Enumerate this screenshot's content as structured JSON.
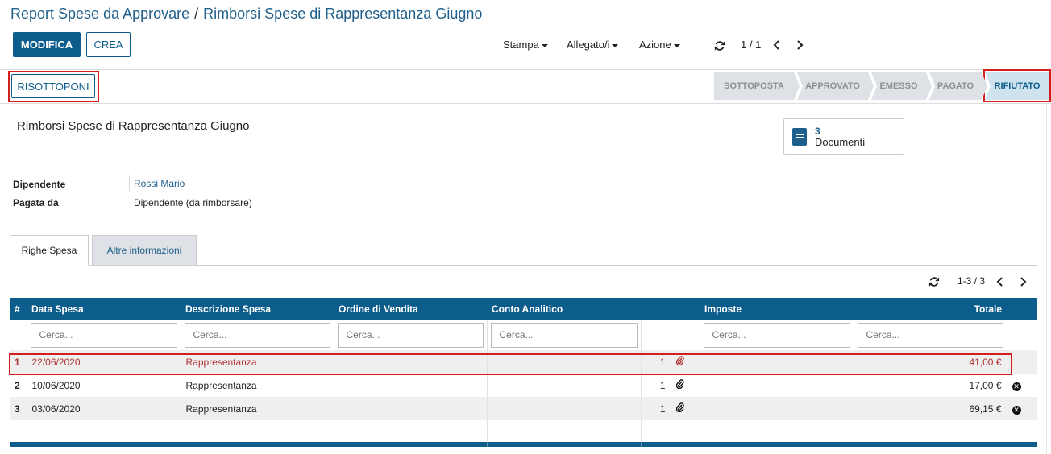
{
  "breadcrumb": {
    "parent": "Report Spese da Approvare",
    "separator": "/",
    "current": "Rimborsi Spese di Rappresentanza Giugno"
  },
  "control_panel": {
    "edit_label": "MODIFICA",
    "create_label": "CREA",
    "print_label": "Stampa",
    "attachment_label": "Allegato/i",
    "action_label": "Azione",
    "pager_value": "1 / 1"
  },
  "header_buttons": {
    "resubmit_label": "RISOTTOPONI"
  },
  "statusbar": {
    "stages": [
      "SOTTOPOSTA",
      "APPROVATO",
      "EMESSO",
      "PAGATO",
      "RIFIUTATO"
    ],
    "active_stage": "RIFIUTATO"
  },
  "record": {
    "title": "Rimborsi Spese di Rappresentanza Giugno",
    "documents_count": "3",
    "documents_label": "Documenti",
    "fields": [
      {
        "label": "Dipendente",
        "value": "Rossi Mario"
      },
      {
        "label": "Pagata da",
        "value": "Dipendente (da rimborsare)"
      }
    ]
  },
  "tabs": [
    "Righe Spesa",
    "Altre informazioni"
  ],
  "lines": {
    "pager": "1-3 / 3",
    "columns": [
      "#",
      "Data Spesa",
      "Descrizione Spesa",
      "Ordine di Vendita",
      "Conto Analitico",
      "",
      "",
      "Imposte",
      "Totale",
      ""
    ],
    "filter_placeholder": "Cerca...",
    "rows": [
      {
        "index": "1",
        "date": "22/06/2020",
        "description": "Rappresentanza",
        "sale_order": "",
        "analytic": "",
        "attachments": "1",
        "taxes": "",
        "total": "41,00 €"
      },
      {
        "index": "2",
        "date": "10/06/2020",
        "description": "Rappresentanza",
        "sale_order": "",
        "analytic": "",
        "attachments": "1",
        "taxes": "",
        "total": "17,00 €"
      },
      {
        "index": "3",
        "date": "03/06/2020",
        "description": "Rappresentanza",
        "sale_order": "",
        "analytic": "",
        "attachments": "1",
        "taxes": "",
        "total": "69,15 €"
      }
    ]
  },
  "colors": {
    "primary": "#0d5d8c",
    "link": "#1f5f8b",
    "highlight": "#d11f1f",
    "selected_row_text": "#b03030",
    "active_stage_bg": "#cfe3ee"
  }
}
